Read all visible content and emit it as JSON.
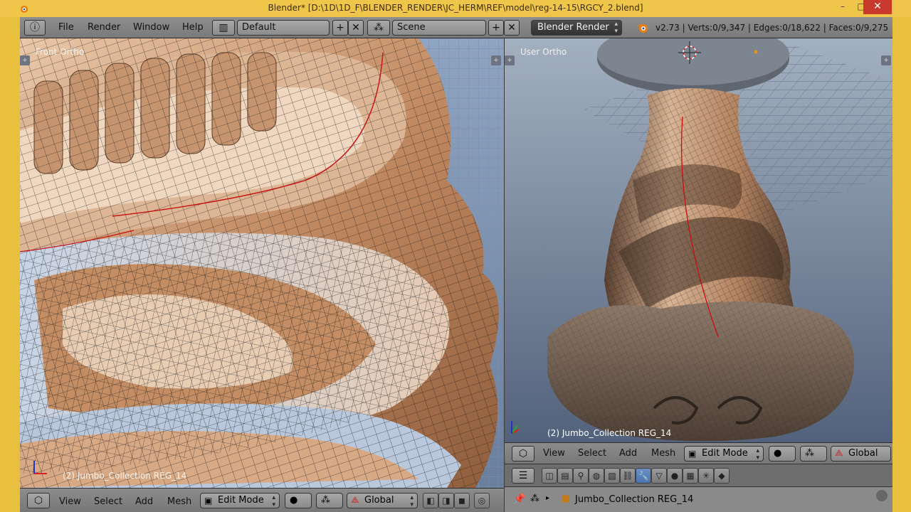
{
  "window": {
    "title": "Blender* [D:\\1D\\1D_F\\BLENDER_RENDER\\JC_HERM\\REF\\model\\reg-14-15\\RGCY_2.blend]",
    "minimize": "–",
    "maximize": "□",
    "close": "✕"
  },
  "info_header": {
    "menus": [
      "File",
      "Render",
      "Window",
      "Help"
    ],
    "layout": "Default",
    "scene": "Scene",
    "engine": "Blender Render",
    "stats": "v2.73 | Verts:0/9,347 | Edges:0/18,622 | Faces:0/9,275"
  },
  "viewport_left": {
    "label": "Front Ortho",
    "object_label": "(2) Jumbo_Collection REG_14",
    "header": {
      "menus": [
        "View",
        "Select",
        "Add",
        "Mesh"
      ],
      "mode": "Edit Mode",
      "orientation": "Global"
    }
  },
  "viewport_right": {
    "label": "User Ortho",
    "object_label": "(2) Jumbo_Collection REG_14",
    "header": {
      "menus": [
        "View",
        "Select",
        "Add",
        "Mesh"
      ],
      "mode": "Edit Mode",
      "orientation": "Global"
    }
  },
  "outliner": {
    "item": "Jumbo_Collection REG_14"
  },
  "colors": {
    "frame": "#e9bf3e",
    "header_gray": "#828282",
    "viewport_bg": "#6c7b93",
    "mesh_warm": "#c9946a",
    "mesh_cool": "#9fb3d0",
    "wire": "#1a1a1a",
    "seam": "#d01010",
    "active_tool": "#5278b8"
  }
}
